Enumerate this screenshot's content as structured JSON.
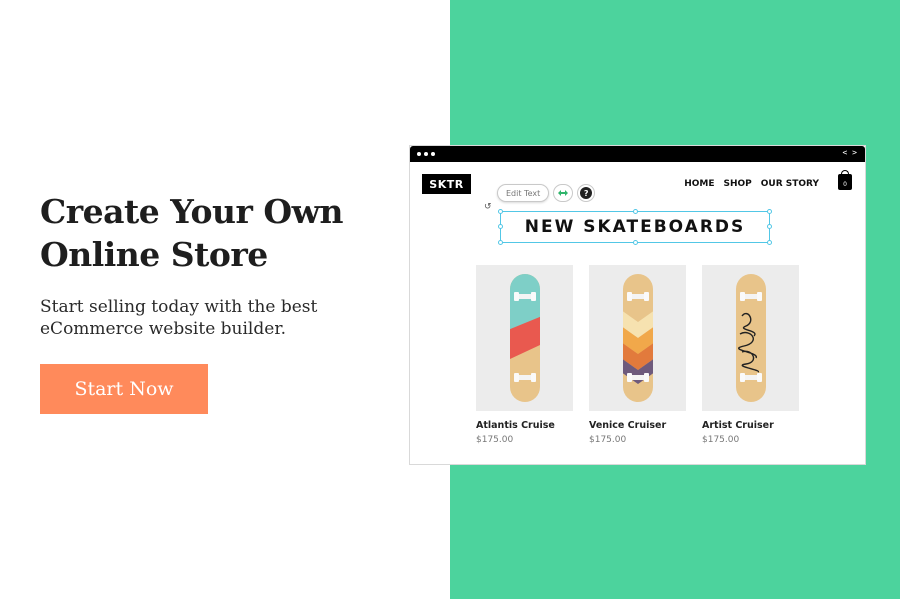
{
  "hero": {
    "title": "Create Your Own Online Store",
    "subtitle": "Start selling today with the best eCommerce website builder.",
    "cta_label": "Start Now"
  },
  "colors": {
    "panel_green": "#4cd39d",
    "cta_orange": "#ff8a5b",
    "selection_blue": "#52c7e6"
  },
  "mockup": {
    "code_icon": "< >",
    "logo": "SKTR",
    "nav": [
      "HOME",
      "SHOP",
      "OUR STORY"
    ],
    "cart_count": "0",
    "editor": {
      "edit_text_label": "Edit Text",
      "link_icon": "link-icon",
      "help_label": "?"
    },
    "heading": "NEW SKATEBOARDS",
    "products": [
      {
        "name": "Atlantis Cruise",
        "price": "$175.00",
        "design": "teal-red-stripe"
      },
      {
        "name": "Venice Cruiser",
        "price": "$175.00",
        "design": "chevron"
      },
      {
        "name": "Artist Cruiser",
        "price": "$175.00",
        "design": "script"
      }
    ]
  }
}
